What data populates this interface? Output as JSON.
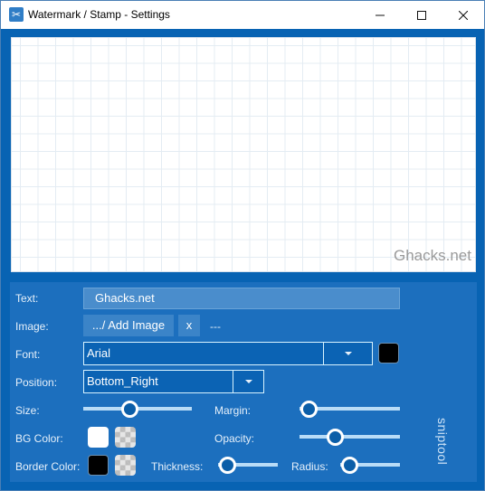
{
  "window": {
    "title": "Watermark / Stamp - Settings",
    "icon": "scissors-icon",
    "controls": {
      "minimize": "—",
      "maximize": "☐",
      "close": "✕"
    }
  },
  "preview": {
    "watermark_text": "Ghacks.net"
  },
  "settings": {
    "text_label": "Text:",
    "text_value": "Ghacks.net",
    "image_label": "Image:",
    "add_image_button": ".../ Add Image",
    "clear_image_button": "x",
    "image_value": "---",
    "font_label": "Font:",
    "font_value": "Arial",
    "font_color": "#000000",
    "position_label": "Position:",
    "position_value": "Bottom_Right",
    "size_label": "Size:",
    "size_value_fraction": 0.41,
    "margin_label": "Margin:",
    "margin_value_fraction": 0.0,
    "bg_color_label": "BG Color:",
    "bg_color": "#ffffff",
    "opacity_label": "Opacity:",
    "opacity_value_fraction": 0.32,
    "border_color_label": "Border Color:",
    "border_color": "#000000",
    "thickness_label": "Thickness:",
    "thickness_value_fraction": 0.0,
    "radius_label": "Radius:",
    "radius_value_fraction": 0.0
  },
  "brand": "sniptool"
}
